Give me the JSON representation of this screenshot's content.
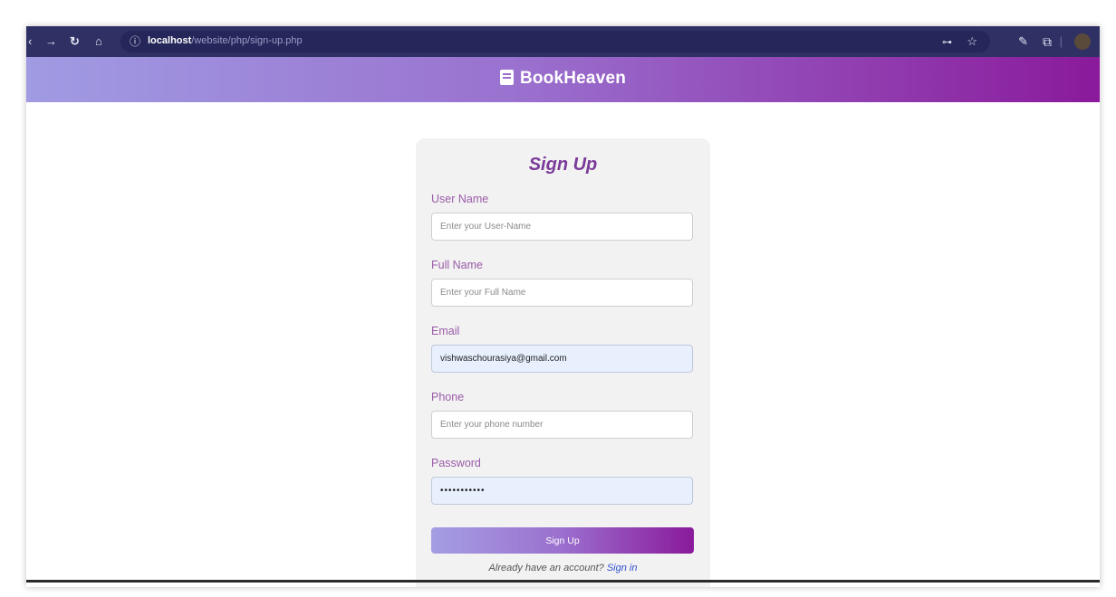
{
  "browser": {
    "url_host": "localhost",
    "url_path": "/website/php/sign-up.php",
    "nav_icons": {
      "back": "back-arrow-icon",
      "forward": "forward-arrow-icon",
      "reload": "reload-icon",
      "home": "home-icon",
      "info": "site-info-icon"
    },
    "right_icons": [
      "password-key-icon",
      "star-icon",
      "pen-icon",
      "extension-icon",
      "profile-avatar-icon"
    ]
  },
  "header": {
    "brand": "BookHeaven",
    "icon": "book-icon"
  },
  "form": {
    "title": "Sign Up",
    "fields": [
      {
        "label": "User Name",
        "placeholder": "Enter your User-Name",
        "value": ""
      },
      {
        "label": "Full Name",
        "placeholder": "Enter your Full Name",
        "value": ""
      },
      {
        "label": "Email",
        "placeholder": "",
        "value": "vishwaschourasiya@gmail.com"
      },
      {
        "label": "Phone",
        "placeholder": "Enter your phone number",
        "value": ""
      },
      {
        "label": "Password",
        "placeholder": "",
        "value": "•••••••••••"
      }
    ],
    "submit_label": "Sign Up",
    "signin_prompt": "Already have an account?",
    "signin_link": "Sign in"
  },
  "colors": {
    "toolbar": "#2f3165",
    "header_start": "#a09be3",
    "header_end": "#8a1a9b",
    "title": "#7b3a9a",
    "label": "#9a5ca8",
    "autofill": "#e8f0fe",
    "link": "#3050d0"
  }
}
